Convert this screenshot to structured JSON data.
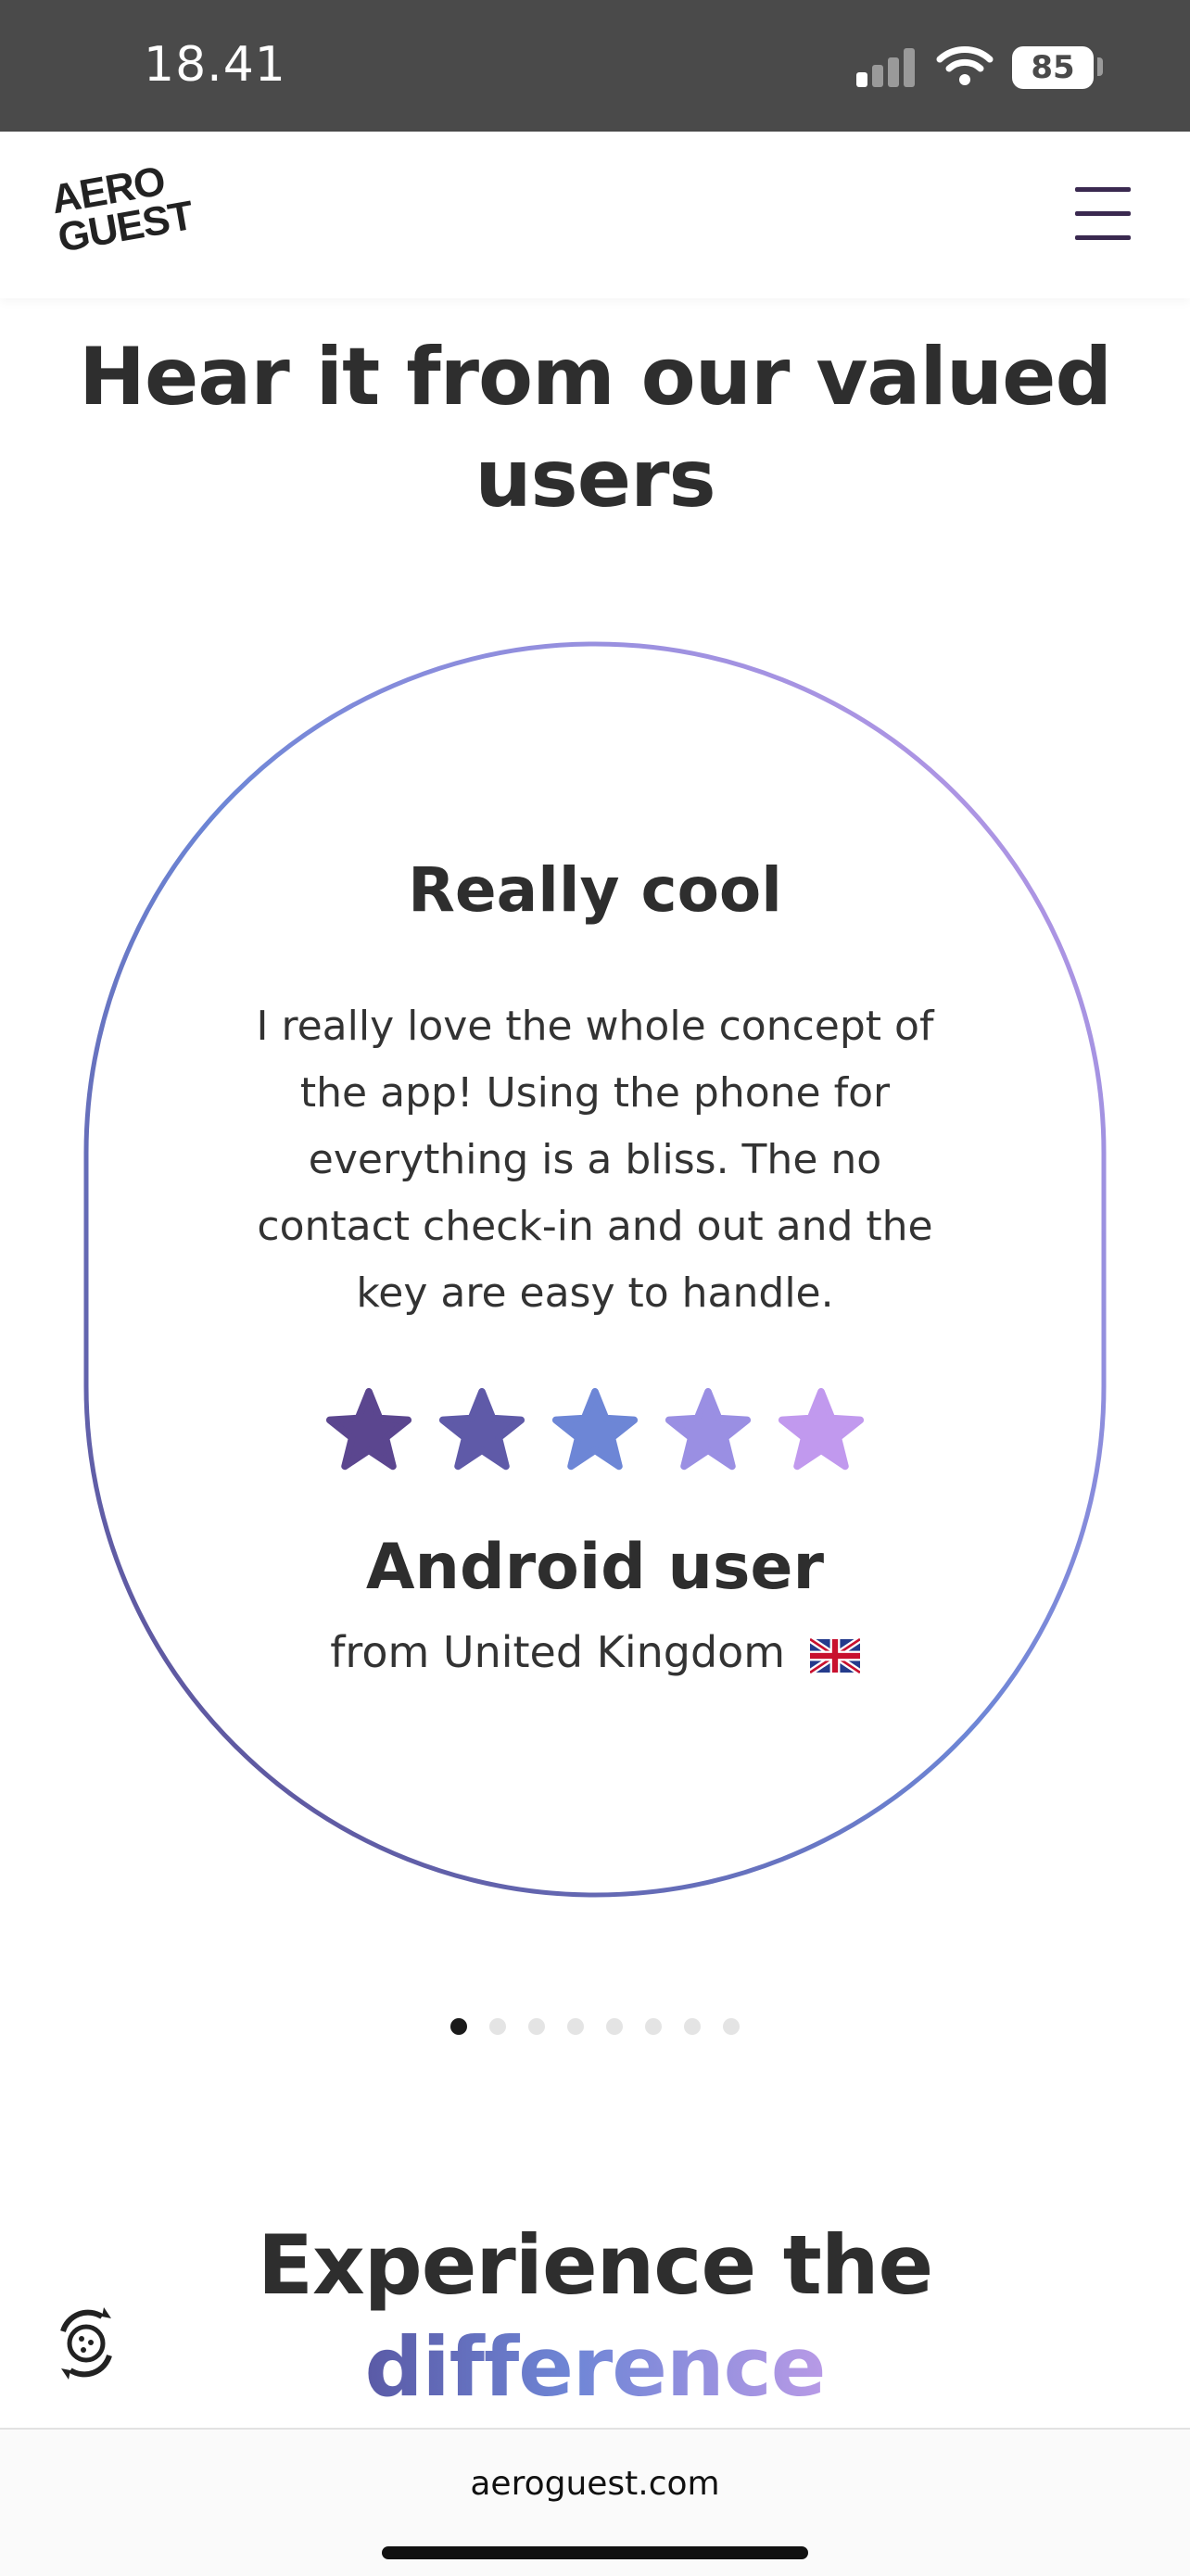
{
  "status_bar": {
    "time": "18.41",
    "battery": "85",
    "icons": [
      "signal-icon",
      "wifi-icon",
      "battery-icon"
    ]
  },
  "header": {
    "logo_line1": "AERO",
    "logo_line2": "GUEST",
    "menu_icon": "hamburger-menu-icon"
  },
  "section": {
    "title_line1": "Hear it from our valued",
    "title_line2": "users"
  },
  "review": {
    "title": "Really cool",
    "text_lines": [
      "I really love the whole concept of",
      "the app! Using the phone for",
      "everything is a bliss. The no",
      "contact check-in and out and the",
      "key are easy to handle."
    ],
    "rating": 5,
    "rating_max": 5,
    "star_colors": [
      "#5b468f",
      "#5f5aa8",
      "#6d86d6",
      "#9a8fe3",
      "#c199ee"
    ],
    "reviewer_name": "Android user",
    "reviewer_origin": "from United Kingdom",
    "flag_icon": "uk-flag-icon"
  },
  "pagination": {
    "total": 8,
    "active_index": 0
  },
  "experience": {
    "title_line1": "Experience the",
    "title_line2": "difference"
  },
  "browser": {
    "url": "aeroguest.com"
  },
  "colors": {
    "status_bar_bg": "#4a4a4a",
    "text_dark": "#2e2e2e",
    "gradient_start": "#5a4a8f",
    "gradient_mid": "#6d86d6",
    "gradient_end": "#c39ae8"
  }
}
